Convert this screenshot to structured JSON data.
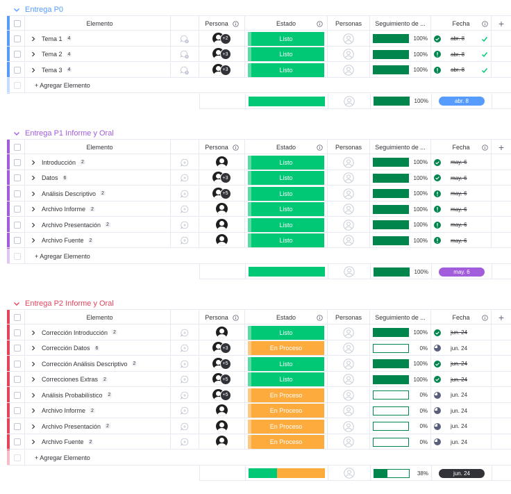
{
  "colors": {
    "done": "#00c875",
    "working": "#fdab3d",
    "track": "#00854d",
    "overdue": "#00854d",
    "p0": "#579bfc",
    "p1": "#a25ddc",
    "p2": "#e2445c"
  },
  "headers": {
    "item": "Elemento",
    "person": "Persona",
    "status": "Estado",
    "people": "Personas",
    "track": "Seguimiento de ...",
    "date": "Fecha",
    "plus": "+"
  },
  "add_item_label": "+ Agregar Elemento",
  "groups": [
    {
      "title": "Entrega P0",
      "color": "#579bfc",
      "timeline_color": "#579bfc",
      "summary": {
        "track_pct": "100%",
        "track_value": 100,
        "date": "abr. 8",
        "status_done_fraction": 1.0
      },
      "items": [
        {
          "name": "Tema 1",
          "subs": "4",
          "extra": "+2",
          "status": "Listo",
          "status_kind": "done",
          "pct": "100%",
          "pct_value": 100,
          "date": "abr. 8",
          "date_strike": true,
          "date_icon": "overdue-ok",
          "check": true,
          "upd": "update-alert"
        },
        {
          "name": "Tema 2",
          "subs": "4",
          "extra": "+3",
          "status": "Listo",
          "status_kind": "done",
          "pct": "100%",
          "pct_value": 100,
          "date": "abr. 8",
          "date_strike": true,
          "date_icon": "overdue-alert",
          "check": true,
          "upd": "update-alert"
        },
        {
          "name": "Tema 3",
          "subs": "4",
          "extra": "+3",
          "status": "Listo",
          "status_kind": "done",
          "pct": "100%",
          "pct_value": 100,
          "date": "abr. 8",
          "date_strike": true,
          "date_icon": "overdue-alert",
          "check": true,
          "upd": "update-alert"
        }
      ]
    },
    {
      "title": "Entrega P1 Informe y Oral",
      "color": "#a25ddc",
      "timeline_color": "#a25ddc",
      "summary": {
        "track_pct": "100%",
        "track_value": 100,
        "date": "may. 6",
        "status_done_fraction": 1.0
      },
      "items": [
        {
          "name": "Introducción",
          "subs": "2",
          "extra": "",
          "status": "Listo",
          "status_kind": "done",
          "pct": "100%",
          "pct_value": 100,
          "date": "may. 6",
          "date_strike": true,
          "date_icon": "overdue-ok",
          "check": false,
          "upd": "update"
        },
        {
          "name": "Datos",
          "subs": "6",
          "extra": "+3",
          "status": "Listo",
          "status_kind": "done",
          "pct": "100%",
          "pct_value": 100,
          "date": "may. 6",
          "date_strike": true,
          "date_icon": "overdue-ok",
          "check": false,
          "upd": "update"
        },
        {
          "name": "Análisis Descriptivo",
          "subs": "2",
          "extra": "+5",
          "status": "Listo",
          "status_kind": "done",
          "pct": "100%",
          "pct_value": 100,
          "date": "may. 6",
          "date_strike": true,
          "date_icon": "overdue-alert",
          "check": false,
          "upd": "update"
        },
        {
          "name": "Archivo Informe",
          "subs": "2",
          "extra": "",
          "status": "Listo",
          "status_kind": "done",
          "pct": "100%",
          "pct_value": 100,
          "date": "may. 6",
          "date_strike": true,
          "date_icon": "overdue-alert",
          "check": false,
          "upd": "update"
        },
        {
          "name": "Archivo Presentación",
          "subs": "2",
          "extra": "",
          "status": "Listo",
          "status_kind": "done",
          "pct": "100%",
          "pct_value": 100,
          "date": "may. 6",
          "date_strike": true,
          "date_icon": "overdue-alert",
          "check": false,
          "upd": "update"
        },
        {
          "name": "Archivo Fuente",
          "subs": "2",
          "extra": "",
          "status": "Listo",
          "status_kind": "done",
          "pct": "100%",
          "pct_value": 100,
          "date": "may. 6",
          "date_strike": true,
          "date_icon": "overdue-alert",
          "check": false,
          "upd": "update"
        }
      ]
    },
    {
      "title": "Entrega P2 Informe y Oral",
      "color": "#e2445c",
      "timeline_color": "#323338",
      "summary": {
        "track_pct": "38%",
        "track_value": 38,
        "date": "jun. 24",
        "status_done_fraction": 0.375
      },
      "items": [
        {
          "name": "Corrección Introducción",
          "subs": "2",
          "extra": "",
          "status": "Listo",
          "status_kind": "done",
          "pct": "100%",
          "pct_value": 100,
          "date": "jun. 24",
          "date_strike": true,
          "date_icon": "overdue-ok",
          "check": false,
          "upd": "update"
        },
        {
          "name": "Corrección Datos",
          "subs": "6",
          "extra": "+3",
          "status": "En Proceso",
          "status_kind": "working",
          "pct": "0%",
          "pct_value": 0,
          "date": "jun. 24",
          "date_strike": false,
          "date_icon": "pending",
          "check": false,
          "upd": "update"
        },
        {
          "name": "Corrección Análisis Descriptivo",
          "subs": "2",
          "extra": "+5",
          "status": "Listo",
          "status_kind": "done",
          "pct": "100%",
          "pct_value": 100,
          "date": "jun. 24",
          "date_strike": true,
          "date_icon": "overdue-ok",
          "check": false,
          "upd": "update"
        },
        {
          "name": "Correcciones Extras",
          "subs": "2",
          "extra": "+5",
          "status": "Listo",
          "status_kind": "done",
          "pct": "100%",
          "pct_value": 100,
          "date": "jun. 24",
          "date_strike": true,
          "date_icon": "overdue-ok",
          "check": false,
          "upd": "update"
        },
        {
          "name": "Análisis Probabilístico",
          "subs": "2",
          "extra": "+5",
          "status": "En Proceso",
          "status_kind": "working",
          "pct": "0%",
          "pct_value": 0,
          "date": "jun. 24",
          "date_strike": false,
          "date_icon": "pending",
          "check": false,
          "upd": "update"
        },
        {
          "name": "Archivo Informe",
          "subs": "2",
          "extra": "",
          "status": "En Proceso",
          "status_kind": "working",
          "pct": "0%",
          "pct_value": 0,
          "date": "jun. 24",
          "date_strike": false,
          "date_icon": "pending",
          "check": false,
          "upd": "update"
        },
        {
          "name": "Archivo Presentación",
          "subs": "2",
          "extra": "",
          "status": "En Proceso",
          "status_kind": "working",
          "pct": "0%",
          "pct_value": 0,
          "date": "jun. 24",
          "date_strike": false,
          "date_icon": "pending",
          "check": false,
          "upd": "update"
        },
        {
          "name": "Archivo Fuente",
          "subs": "2",
          "extra": "",
          "status": "En Proceso",
          "status_kind": "working",
          "pct": "0%",
          "pct_value": 0,
          "date": "jun. 24",
          "date_strike": false,
          "date_icon": "pending",
          "check": false,
          "upd": "update"
        }
      ]
    }
  ]
}
